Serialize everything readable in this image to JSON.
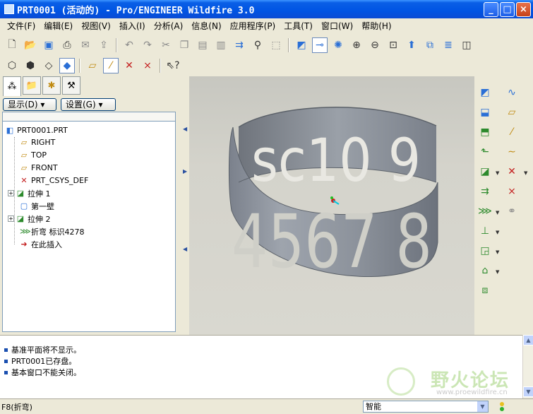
{
  "window": {
    "title": "PRT0001 (活动的) - Pro/ENGINEER Wildfire 3.0",
    "minimize_label": "_",
    "maximize_label": "□",
    "close_label": "×"
  },
  "menubar": {
    "items": [
      "文件(F)",
      "编辑(E)",
      "视图(V)",
      "插入(I)",
      "分析(A)",
      "信息(N)",
      "应用程序(P)",
      "工具(T)",
      "窗口(W)",
      "帮助(H)"
    ]
  },
  "toolbar_main": {
    "icons": [
      "new-icon",
      "open-icon",
      "save-icon",
      "print-icon",
      "send-email-icon",
      "undo-icon",
      "redo-icon",
      "cut-icon",
      "copy-icon",
      "paste-icon",
      "paste-special-icon",
      "regenerate-icon",
      "find-icon",
      "select-box-icon",
      "model-display-icon",
      "datum-display-icon",
      "saved-views-icon",
      "zoom-in-icon",
      "zoom-out-icon",
      "refit-icon",
      "reorient-icon",
      "layers-icon",
      "setup-icon"
    ]
  },
  "panel": {
    "show_label": "显示(D) ▾",
    "settings_label": "设置(G) ▾"
  },
  "model_tree": {
    "root": "PRT0001.PRT",
    "items": [
      {
        "label": "RIGHT",
        "icon": "datum-plane-icon"
      },
      {
        "label": "TOP",
        "icon": "datum-plane-icon"
      },
      {
        "label": "FRONT",
        "icon": "datum-plane-icon"
      },
      {
        "label": "PRT_CSYS_DEF",
        "icon": "csys-icon"
      },
      {
        "label": "拉伸 1",
        "icon": "extrude-icon"
      },
      {
        "label": "第一壁",
        "icon": "first-wall-icon"
      },
      {
        "label": "拉伸 2",
        "icon": "extrude-icon"
      },
      {
        "label": "折弯 标识4278",
        "icon": "bend-icon"
      },
      {
        "label": "在此插入",
        "icon": "insert-here-icon"
      }
    ]
  },
  "messages": {
    "lines": [
      "基准平面将不显示。",
      "PRT0001已存盘。",
      "基本窗口不能关闭。"
    ]
  },
  "status": {
    "left_text": "F8(折弯)",
    "filter_value": "智能"
  },
  "watermark": {
    "text": "野火论坛",
    "url": "www.proewildfire.cn"
  },
  "model_text": {
    "top_row": "sc10 9",
    "bottom_row": "4567 8"
  },
  "colors": {
    "titlebar": "#0054e3",
    "model_grey": "#8e949e",
    "viewport_bg": "#d4d3cb"
  }
}
